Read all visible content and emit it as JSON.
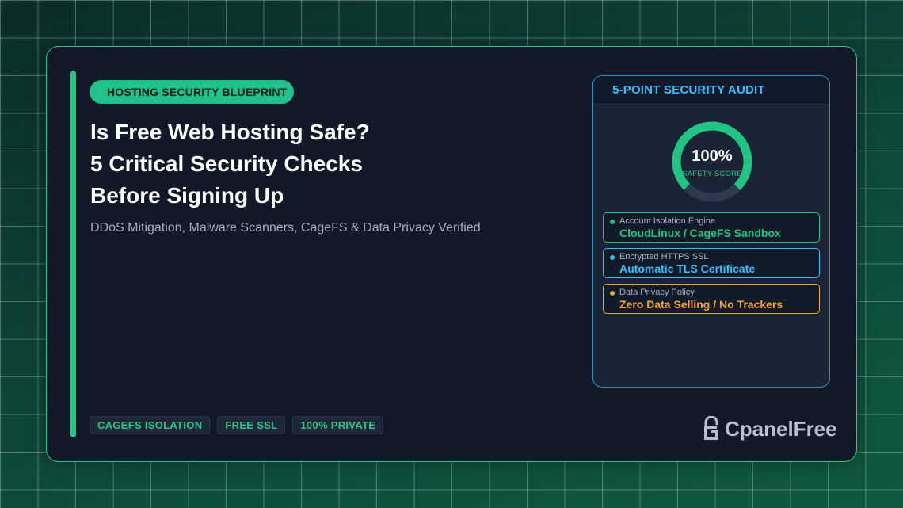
{
  "badge": "HOSTING SECURITY BLUEPRINT",
  "title": {
    "line1": "Is Free Web Hosting Safe?",
    "line2": "5 Critical Security Checks",
    "line3": "Before Signing Up"
  },
  "subtitle": "DDoS Mitigation, Malware Scanners, CageFS & Data Privacy Verified",
  "tags": [
    "CAGEFS ISOLATION",
    "FREE SSL",
    "100% PRIVATE"
  ],
  "logo": {
    "text": "CpanelFree",
    "icon": "padlock-logo-icon"
  },
  "audit": {
    "title": "5-POINT SECURITY AUDIT",
    "score_value": "100%",
    "score_label": "SAFETY SCORE",
    "score_fraction": 0.75,
    "checks": [
      {
        "label": "Account Isolation Engine",
        "value": "CloudLinux / CageFS Sandbox",
        "color": "#22c483"
      },
      {
        "label": "Encrypted HTTPS SSL",
        "value": "Automatic TLS Certificate",
        "color": "#38bdf8"
      },
      {
        "label": "Data Privacy Policy",
        "value": "Zero Data Selling / No Trackers",
        "color": "#f5a524"
      }
    ]
  },
  "colors": {
    "accent_green": "#22c483",
    "accent_blue": "#38bdf8",
    "accent_amber": "#f5a524",
    "card_bg": "#111827"
  }
}
